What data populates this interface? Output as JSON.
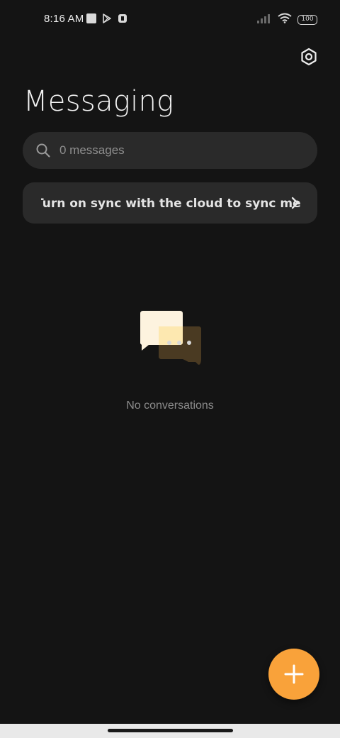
{
  "status_bar": {
    "time": "8:16 AM",
    "battery": "100",
    "icons": [
      "notification-square-icon",
      "play-store-icon",
      "app-badge-icon",
      "signal-icon",
      "wifi-icon",
      "battery-icon"
    ]
  },
  "header": {
    "title": "Messaging",
    "settings_icon": "gear-icon"
  },
  "search": {
    "placeholder": "0 messages",
    "icon": "search-icon"
  },
  "sync_banner": {
    "text": "Turn on sync with the cloud to sync messages",
    "icon": "chevron-right-icon"
  },
  "empty_state": {
    "text": "No conversations",
    "icon": "chat-bubbles-icon"
  },
  "fab": {
    "icon": "plus-icon",
    "color": "#f9a23a"
  },
  "colors": {
    "background": "#141414",
    "surface": "#2a2a2a",
    "accent": "#f9a23a"
  }
}
